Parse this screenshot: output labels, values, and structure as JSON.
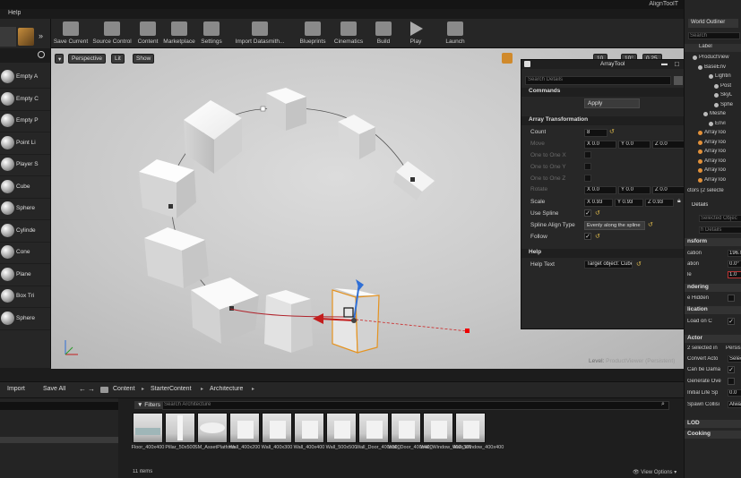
{
  "window": {
    "title": "AlignToolT"
  },
  "menu": {
    "help": "Help"
  },
  "place_panel": {
    "items": [
      {
        "label": "Empty A",
        "icon": "sphere-icon"
      },
      {
        "label": "Empty C",
        "icon": "sphere-icon"
      },
      {
        "label": "Empty P",
        "icon": "sphere-icon"
      },
      {
        "label": "Point Li",
        "icon": "light-bulb-icon"
      },
      {
        "label": "Player S",
        "icon": "player-icon"
      },
      {
        "label": "Cube",
        "icon": "cube-icon"
      },
      {
        "label": "Sphere",
        "icon": "sphere-icon"
      },
      {
        "label": "Cylinde",
        "icon": "cylinder-icon"
      },
      {
        "label": "Cone",
        "icon": "cone-icon"
      },
      {
        "label": "Plane",
        "icon": "plane-icon"
      },
      {
        "label": "Box Tri",
        "icon": "box-trigger-icon"
      },
      {
        "label": "Sphere",
        "icon": "sphere-icon"
      }
    ]
  },
  "toolbar": {
    "items": [
      {
        "label": "Save Current",
        "icon": "save-icon"
      },
      {
        "label": "Source Control",
        "icon": "source-control-icon"
      },
      {
        "label": "Content",
        "icon": "content-icon"
      },
      {
        "label": "Marketplace",
        "icon": "marketplace-icon"
      },
      {
        "label": "Settings",
        "icon": "settings-icon"
      },
      {
        "label": "Import Datasmith...",
        "icon": "datasmith-icon"
      },
      {
        "label": "Blueprints",
        "icon": "blueprints-icon"
      },
      {
        "label": "Cinematics",
        "icon": "cinematics-icon"
      },
      {
        "label": "Build",
        "icon": "build-icon"
      },
      {
        "label": "Play",
        "icon": "play-icon"
      },
      {
        "label": "Launch",
        "icon": "launch-icon"
      }
    ]
  },
  "viewport": {
    "perspective": "Perspective",
    "lit": "Lit",
    "show": "Show",
    "grid_snap": "10",
    "rot_snap": "10°",
    "scale_snap": "0.25",
    "level_label": "Level:",
    "level_name": "ProductViewer (Persistent)"
  },
  "array_tool": {
    "title": "ArrayTool",
    "search_placeholder": "Search Details",
    "commands_header": "Commands",
    "apply_label": "Apply",
    "transform_header": "Array Transformation",
    "count_label": "Count",
    "count_value": "8",
    "move_label": "Move",
    "move_x": "X 0.0",
    "move_y": "Y 0.0",
    "move_z": "Z 0.0",
    "one_to_one_x": "One to One X",
    "one_to_one_y": "One to One Y",
    "one_to_one_z": "One to One Z",
    "rotate_label": "Rotate",
    "rotate_x": "X 0.0",
    "rotate_y": "Y 0.0",
    "rotate_z": "Z 0.0",
    "scale_label": "Scale",
    "scale_x": "X 0.93",
    "scale_y": "Y 0.93",
    "scale_z": "Z 0.93",
    "use_spline_label": "Use Spline",
    "spline_align_label": "Spline Align Type",
    "spline_align_value": "Evenly along the spline",
    "follow_label": "Follow",
    "help_header": "Help",
    "help_text_label": "Help Text",
    "help_text_value": "Target object: Cube"
  },
  "world_outliner": {
    "tab": "World Outliner",
    "search_placeholder": "Search",
    "column_label": "Label",
    "items": [
      "ProductView",
      "BaseEnv",
      "Lightin",
      "Post",
      "SkyL",
      "Sphe",
      "Meshe",
      "Envi",
      "ArrayToo",
      "ArrayToo",
      "ArrayToo",
      "ArrayToo",
      "ArrayToo",
      "ArrayToo"
    ],
    "count_text": "ctors (2 selecte"
  },
  "details": {
    "tab": "Details",
    "selected_text": "Selected Objec",
    "search_placeholder": "h Details",
    "transform_header": "nsform",
    "location_label": "cation",
    "location_value": "196.0",
    "rotation_label": "ation",
    "rotation_value": "0.0°",
    "scale_label": "le",
    "scale_value": "1.0",
    "rendering_header": "ndering",
    "hidden_label": "e Hidden",
    "replication_header": "lication",
    "net_load_label": "Load on C",
    "actor_header": "Actor",
    "selected_in": "2 selected in",
    "persist_label": "Persis",
    "convert_actor_label": "Convert Acto",
    "convert_actor_value": "Selec",
    "can_be_damaged_label": "Can be Dama",
    "generate_overlap_label": "Generate Ove",
    "initial_life_label": "Initial Life Sp",
    "initial_life_value": "0.0",
    "spawn_collision_label": "Spawn Collisi",
    "spawn_collision_value": "Alwa",
    "lod_header": "LOD",
    "cooking_header": "Cooking"
  },
  "content_browser": {
    "import_label": "Import",
    "save_all_label": "Save All",
    "breadcrumb": [
      "Content",
      "StarterContent",
      "Architecture"
    ],
    "filters_label": "Filters",
    "search_placeholder": "Search Architecture",
    "assets": [
      "Floor_400x400",
      "Pillar_50x500",
      "SM_AssetPlatform",
      "Wall_400x200",
      "Wall_400x300",
      "Wall_400x400",
      "Wall_500x500",
      "Wall_Door_400x300",
      "Wall_Door_400x400",
      "Wall_Window_400x300",
      "Wall_Window_400x400"
    ],
    "item_count": "11 items",
    "view_options": "View Options"
  }
}
